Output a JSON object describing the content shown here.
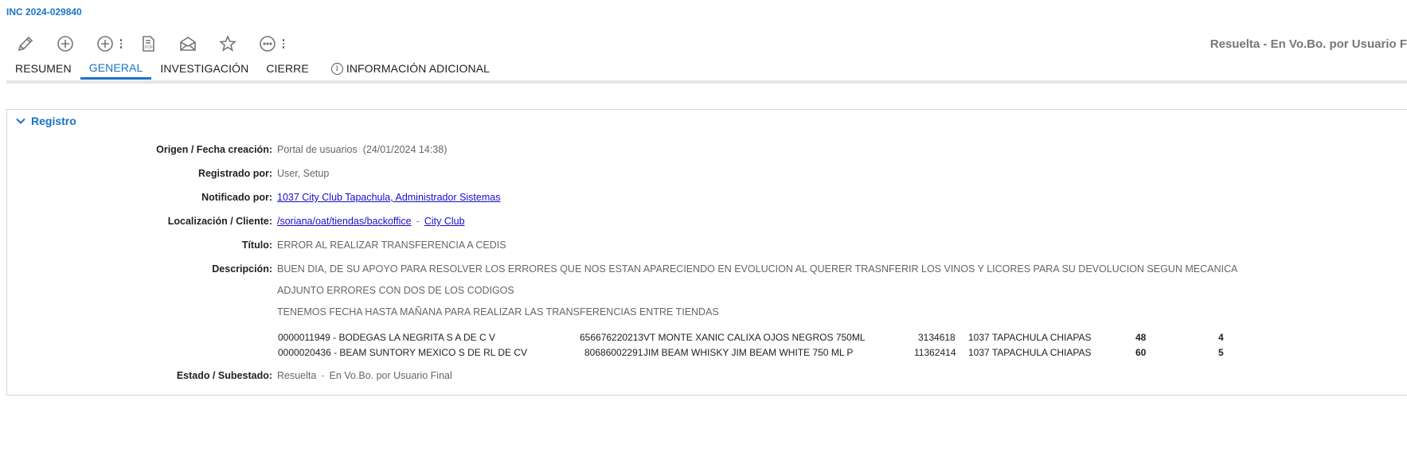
{
  "incident_id": "INC 2024-029840",
  "toolbar": {
    "icons": [
      "pencil-icon",
      "add-icon",
      "add-menu-icon",
      "pdf-icon",
      "mail-icon",
      "star-icon",
      "more-icon"
    ]
  },
  "status_header": "Resuelta - En Vo.Bo. por Usuario F",
  "tabs": [
    {
      "label": "RESUMEN"
    },
    {
      "label": "GENERAL"
    },
    {
      "label": "INVESTIGACIÓN"
    },
    {
      "label": "CIERRE"
    },
    {
      "label": "INFORMACIÓN ADICIONAL"
    }
  ],
  "active_tab": "GENERAL",
  "section": {
    "title": "Registro",
    "fields": {
      "origen": {
        "label": "Origen / Fecha creación:",
        "value": "Portal de usuarios",
        "date": "(24/01/2024 14:38)"
      },
      "registrado": {
        "label": "Registrado por:",
        "value": "User, Setup"
      },
      "notificado": {
        "label": "Notificado por:",
        "link": "1037 City Club Tapachula, Administrador Sistemas"
      },
      "localizacion": {
        "label": "Localización / Cliente:",
        "link1": "/soriana/oat/tiendas/backoffice",
        "separator": "-",
        "link2": "City Club"
      },
      "titulo": {
        "label": "Título:",
        "value": "ERROR AL REALIZAR TRANSFERENCIA A CEDIS"
      },
      "descripcion": {
        "label": "Descripción:",
        "lines": [
          "BUEN DIA, DE SU APOYO PARA RESOLVER LOS ERRORES QUE NOS ESTAN APARECIENDO EN EVOLUCION AL QUERER TRASNFERIR LOS VINOS Y LICORES PARA SU DEVOLUCION SEGUN MECANICA",
          "ADJUNTO ERRORES CON DOS DE LOS CODIGOS",
          "TENEMOS FECHA HASTA MAÑANA PARA REALIZAR LAS TRANSFERENCIAS ENTRE TIENDAS"
        ],
        "rows": [
          {
            "proveedor": "0000011949 - BODEGAS LA NEGRITA S A DE C V",
            "codigo": "656676220213",
            "articulo": "VT MONTE XANIC CALIXA OJOS NEGROS 750ML",
            "sku": "3134618",
            "tienda": "1037 TAPACHULA CHIAPAS",
            "cant1": "48",
            "cant2": "4"
          },
          {
            "proveedor": "0000020436 - BEAM SUNTORY MEXICO S DE RL DE CV",
            "codigo": "80686002291",
            "articulo": "JIM BEAM WHISKY JIM BEAM WHITE 750 ML P",
            "sku": "11362414",
            "tienda": "1037 TAPACHULA CHIAPAS",
            "cant1": "60",
            "cant2": "5"
          }
        ]
      },
      "estado": {
        "label": "Estado / Subestado:",
        "value": "Resuelta",
        "separator": "-",
        "sub": "En Vo.Bo. por Usuario Final"
      }
    }
  }
}
